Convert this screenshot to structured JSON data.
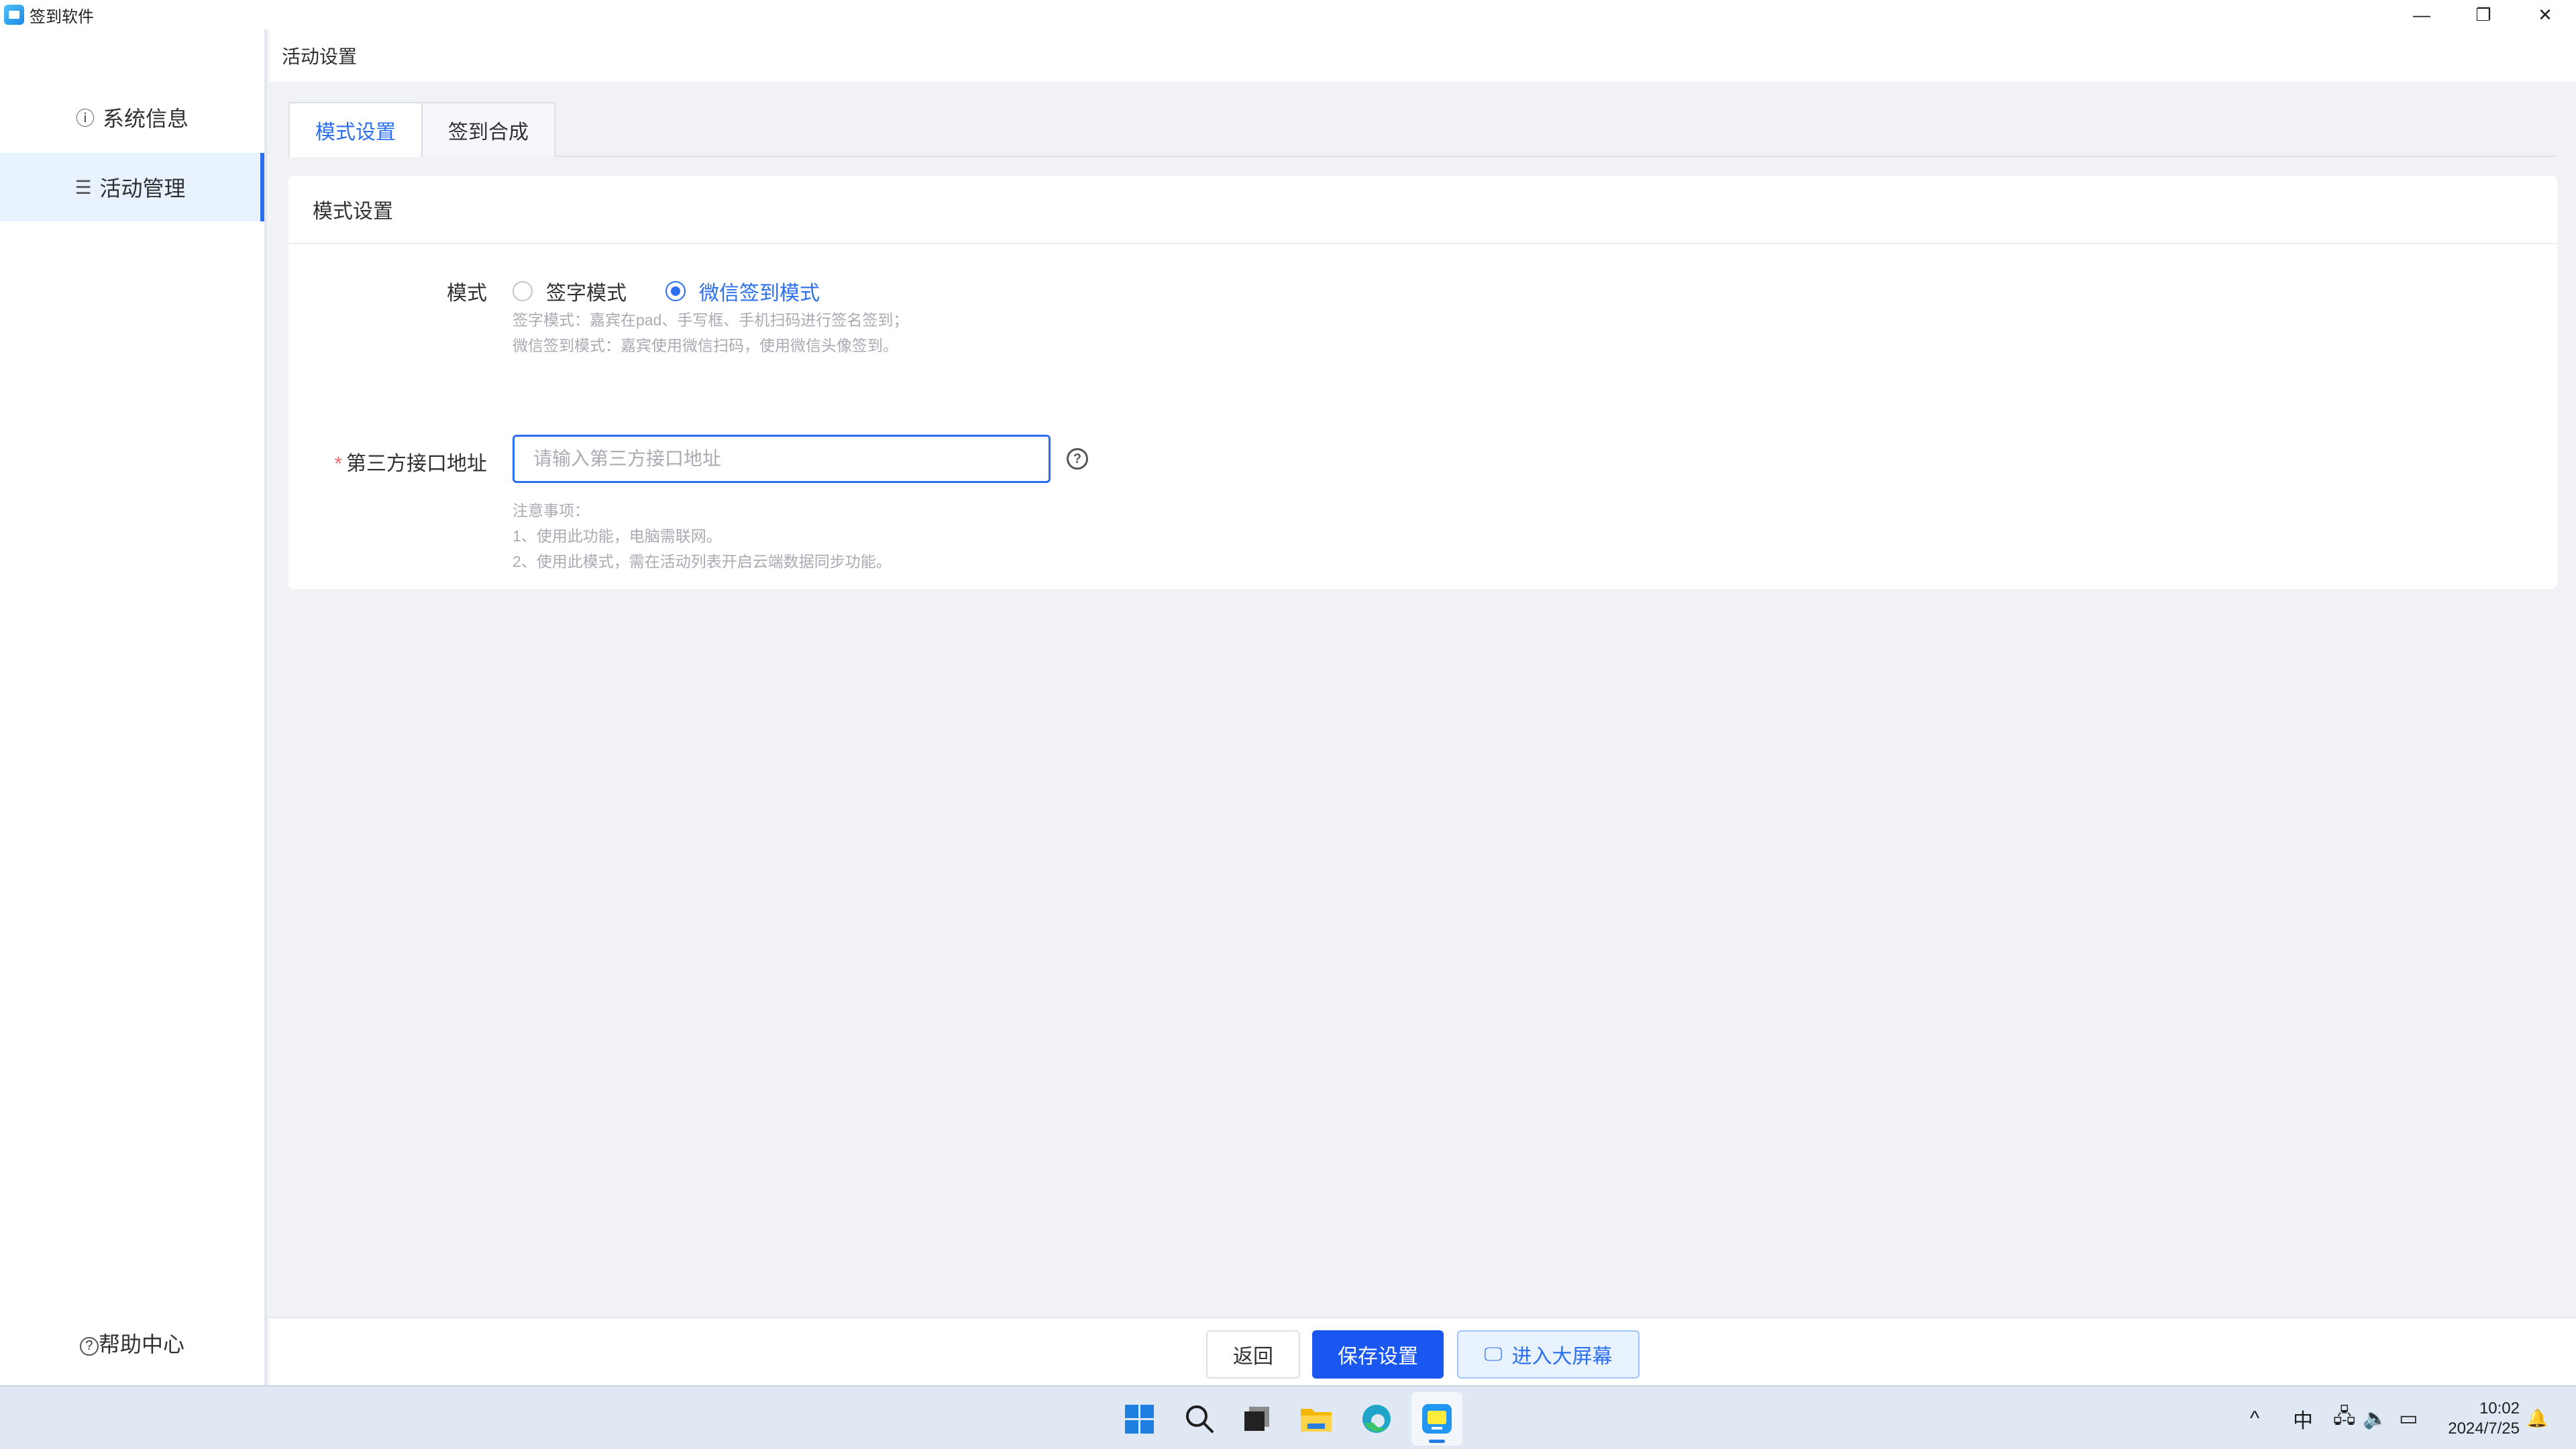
{
  "window": {
    "title": "签到软件",
    "minimize_glyph": "—",
    "restore_glyph": "❐",
    "close_glyph": "✕"
  },
  "sidebar": {
    "items": [
      {
        "label": "系统信息",
        "icon": "info-icon",
        "glyph": "ⓘ"
      },
      {
        "label": "活动管理",
        "icon": "list-icon",
        "glyph": "☰"
      }
    ],
    "active_index": 1,
    "help": {
      "label": "帮助中心",
      "icon": "question-icon",
      "glyph": "?"
    }
  },
  "breadcrumb": "活动设置",
  "tabs": [
    {
      "label": "模式设置"
    },
    {
      "label": "签到合成"
    }
  ],
  "active_tab": 0,
  "card": {
    "title": "模式设置",
    "mode": {
      "label": "模式",
      "options": [
        {
          "label": "签字模式",
          "checked": false
        },
        {
          "label": "微信签到模式",
          "checked": true
        }
      ],
      "hint_lines": [
        "签字模式：嘉宾在pad、手写框、手机扫码进行签名签到；",
        "微信签到模式：嘉宾使用微信扫码，使用微信头像签到。"
      ]
    },
    "api": {
      "required_mark": "*",
      "label": "第三方接口地址",
      "value": "",
      "placeholder": "请输入第三方接口地址",
      "help_glyph": "?",
      "notes": [
        "注意事项：",
        "1、使用此功能，电脑需联网。",
        "2、使用此模式，需在活动列表开启云端数据同步功能。"
      ]
    }
  },
  "footer": {
    "back_label": "返回",
    "save_label": "保存设置",
    "screen_label": "进入大屏幕",
    "screen_icon_glyph": "🖵"
  },
  "taskbar": {
    "search_glyph": "⚲",
    "tray": {
      "chevron_glyph": "^",
      "ime": "中",
      "network_glyph": "🖧",
      "volume_glyph": "🔈",
      "battery_glyph": "▭"
    },
    "time": "10:02",
    "date": "2024/7/25",
    "bell_glyph": "🔔"
  },
  "colors": {
    "accent": "#2b6ff0",
    "primary_button": "#1a56f0",
    "required": "#f56c6c"
  }
}
